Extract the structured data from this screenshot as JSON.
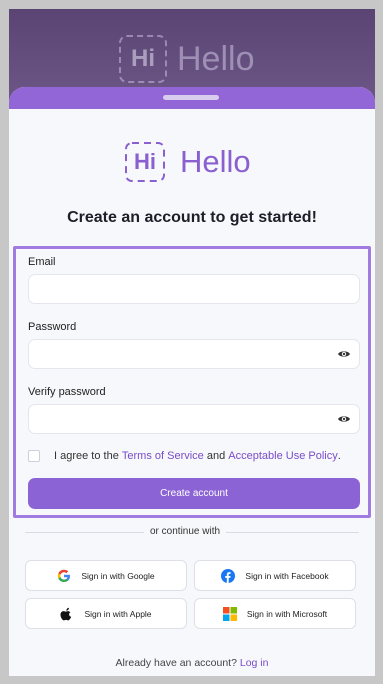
{
  "backdrop": {
    "logo_mark": "Hi",
    "logo_word": "Hello"
  },
  "brand": {
    "logo_mark": "Hi",
    "logo_word": "Hello",
    "accent": "#8c63d4"
  },
  "heading": "Create an account to get started!",
  "form": {
    "email_label": "Email",
    "email_value": "",
    "password_label": "Password",
    "password_value": "",
    "verify_label": "Verify password",
    "verify_value": "",
    "agree_prefix": "I agree to the",
    "terms_link": "Terms of Service",
    "agree_and": "and",
    "aup_link": "Acceptable Use Policy",
    "agree_suffix": ".",
    "submit_label": "Create account"
  },
  "divider_text": "or continue with",
  "social": {
    "google": "Sign in with Google",
    "facebook": "Sign in with Facebook",
    "apple": "Sign in with Apple",
    "microsoft": "Sign in with Microsoft"
  },
  "footer": {
    "prompt": "Already have an account?",
    "login_link": "Log in"
  },
  "icons": [
    "eye-icon",
    "google-icon",
    "facebook-icon",
    "apple-icon",
    "microsoft-icon"
  ]
}
